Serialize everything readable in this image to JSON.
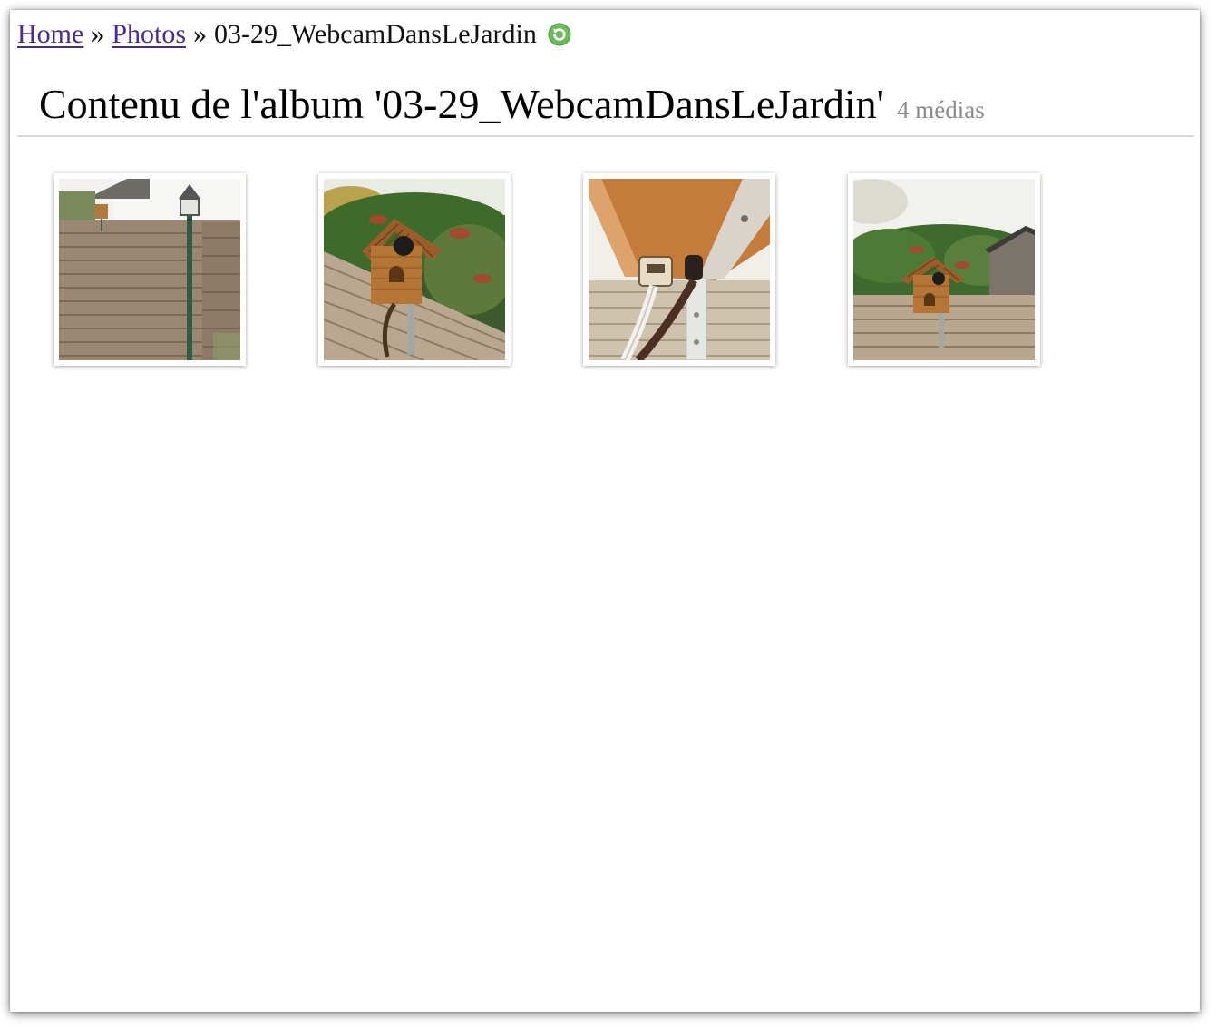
{
  "breadcrumb": {
    "home_label": "Home",
    "photos_label": "Photos",
    "current_label": "03-29_WebcamDansLeJardin",
    "separator": "»",
    "refresh_icon": "refresh-icon"
  },
  "header": {
    "title": "Contenu de l'album '03-29_WebcamDansLeJardin'",
    "media_count": "4 médias"
  },
  "thumbnails": [
    {
      "name": "fence-with-birdhouse-and-lamp",
      "icon": "photo-thumbnail"
    },
    {
      "name": "birdhouse-webcam-closeup",
      "icon": "photo-thumbnail"
    },
    {
      "name": "webcam-cable-underside",
      "icon": "photo-thumbnail"
    },
    {
      "name": "birdhouse-on-fence-garden",
      "icon": "photo-thumbnail"
    }
  ],
  "colors": {
    "link": "#4b2c8c",
    "muted": "#8a8a8a",
    "divider": "#d9d9d9"
  }
}
